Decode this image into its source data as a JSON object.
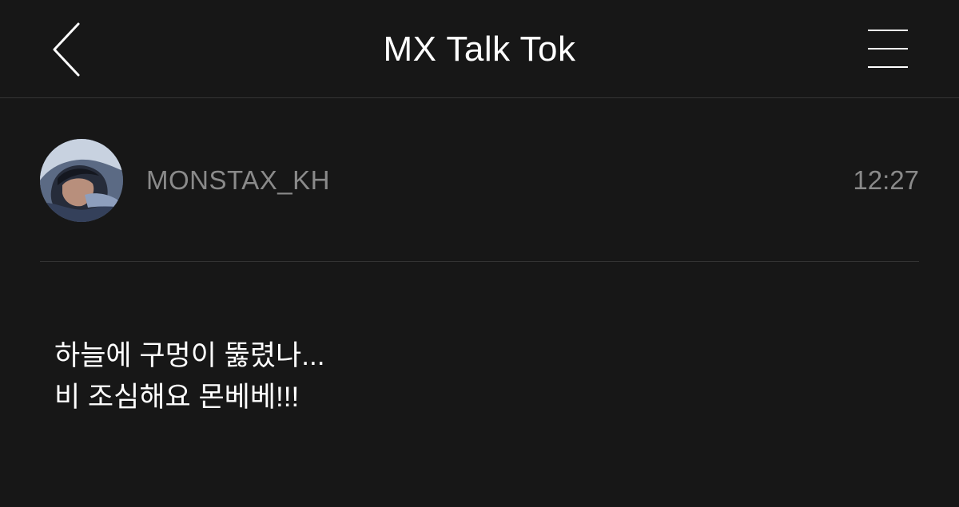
{
  "header": {
    "title": "MX Talk Tok",
    "back_icon": "chevron-left-icon",
    "menu_icon": "hamburger-menu-icon"
  },
  "post": {
    "username": "MONSTAX_KH",
    "time": "12:27",
    "message_lines": [
      "하늘에 구멍이 뚫렸나...",
      "비 조심해요 몬베베!!!"
    ]
  },
  "colors": {
    "background": "#171717",
    "text_primary": "#ffffff",
    "text_secondary": "#8a8a8a",
    "divider": "#333333"
  }
}
